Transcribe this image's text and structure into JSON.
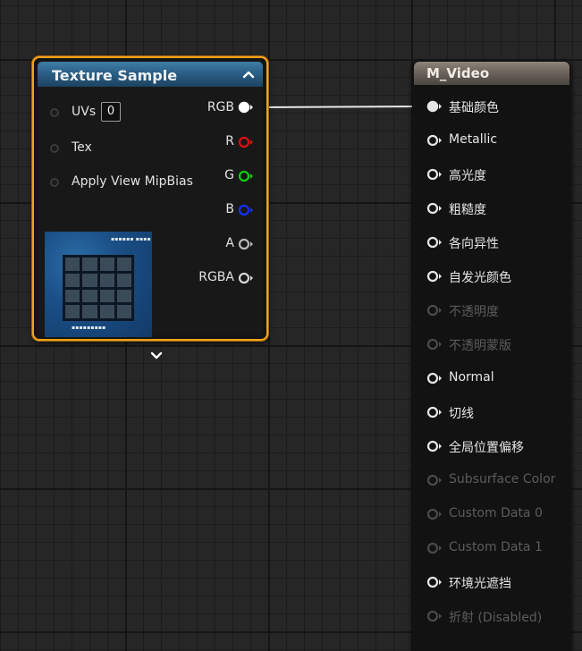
{
  "texture_sample": {
    "title": "Texture Sample",
    "inputs": [
      {
        "label": "UVs",
        "value": "0"
      },
      {
        "label": "Tex"
      },
      {
        "label": "Apply View MipBias"
      }
    ],
    "outputs": [
      {
        "label": "RGB",
        "color": "#ffffff"
      },
      {
        "label": "R",
        "color": "#e01010"
      },
      {
        "label": "G",
        "color": "#10d010"
      },
      {
        "label": "B",
        "color": "#1530ff"
      },
      {
        "label": "A",
        "color": "#b8b8b8"
      },
      {
        "label": "RGBA",
        "color": "#d8d8d8"
      }
    ],
    "border_color": "#f4a21a",
    "header_color": "#2b5f86"
  },
  "material": {
    "title": "M_Video",
    "pins": [
      {
        "label": "基础颜色",
        "enabled": true,
        "connected": true
      },
      {
        "label": "Metallic",
        "enabled": true
      },
      {
        "label": "高光度",
        "enabled": true
      },
      {
        "label": "粗糙度",
        "enabled": true
      },
      {
        "label": "各向异性",
        "enabled": true
      },
      {
        "label": "自发光颜色",
        "enabled": true
      },
      {
        "label": "不透明度",
        "enabled": false
      },
      {
        "label": "不透明蒙版",
        "enabled": false
      },
      {
        "label": "Normal",
        "enabled": true
      },
      {
        "label": "切线",
        "enabled": true
      },
      {
        "label": "全局位置偏移",
        "enabled": true
      },
      {
        "label": "Subsurface Color",
        "enabled": false
      },
      {
        "label": "Custom Data 0",
        "enabled": false
      },
      {
        "label": "Custom Data 1",
        "enabled": false
      },
      {
        "label": "环境光遮挡",
        "enabled": true
      },
      {
        "label": "折射 (Disabled)",
        "enabled": false
      }
    ],
    "header_color": "#6c645b"
  },
  "icons": {
    "collapse": "chevron-up-icon",
    "expand": "chevron-down-icon",
    "pin": "pin-arrow-icon"
  }
}
